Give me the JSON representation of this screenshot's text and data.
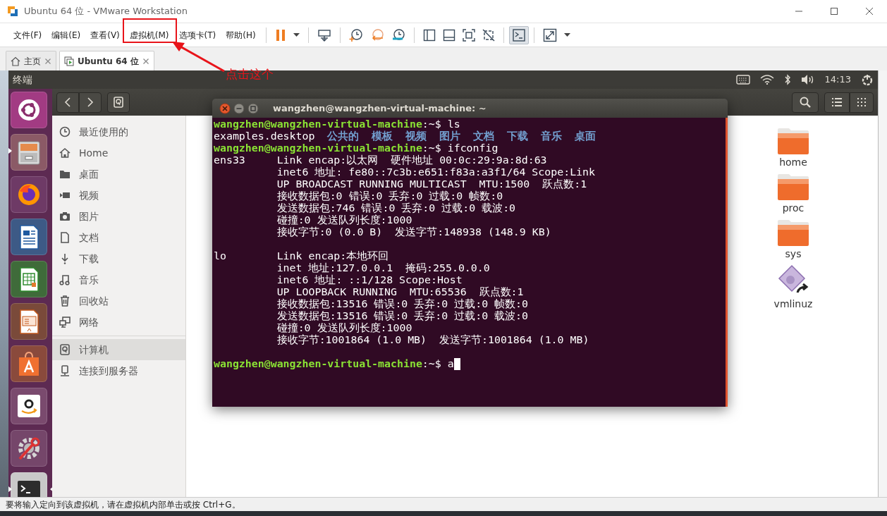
{
  "window": {
    "title": "Ubuntu 64 位 - VMware Workstation"
  },
  "menu": [
    "文件(F)",
    "编辑(E)",
    "查看(V)",
    "虚拟机(M)",
    "选项卡(T)",
    "帮助(H)"
  ],
  "toolbar": [
    {
      "buttons": [
        {
          "kind": "pause",
          "pressed": false
        },
        {
          "kind": "caret",
          "pressed": false
        }
      ]
    },
    {
      "buttons": [
        {
          "kind": "send_keys",
          "pressed": false
        }
      ]
    },
    {
      "buttons": [
        {
          "kind": "snapshot_take",
          "pressed": false
        },
        {
          "kind": "snapshot_revert",
          "pressed": false
        },
        {
          "kind": "snapshot_manager",
          "pressed": false
        }
      ]
    },
    {
      "buttons": [
        {
          "kind": "library",
          "pressed": false
        },
        {
          "kind": "thumbnail",
          "pressed": false
        },
        {
          "kind": "fullscreen",
          "pressed": false
        },
        {
          "kind": "unity",
          "pressed": false
        }
      ]
    },
    {
      "buttons": [
        {
          "kind": "console",
          "pressed": true
        }
      ]
    },
    {
      "buttons": [
        {
          "kind": "stretch",
          "pressed": false
        },
        {
          "kind": "caret",
          "pressed": false
        }
      ]
    }
  ],
  "tabs": [
    {
      "label": "主页",
      "kind": "home",
      "selected": false
    },
    {
      "label": "Ubuntu 64 位",
      "kind": "vm",
      "selected": true
    }
  ],
  "annotation": {
    "text": "点击这个"
  },
  "guest": {
    "panel_title": "终端",
    "clock": "14:13",
    "launcher": [
      {
        "kind": "ubuntu",
        "running": false,
        "focused": false
      },
      {
        "kind": "files",
        "running": true,
        "focused": false
      },
      {
        "kind": "firefox",
        "running": false,
        "focused": false
      },
      {
        "kind": "writer",
        "running": false,
        "focused": false
      },
      {
        "kind": "calc",
        "running": false,
        "focused": false
      },
      {
        "kind": "impress",
        "running": false,
        "focused": false
      },
      {
        "kind": "software",
        "running": false,
        "focused": false
      },
      {
        "kind": "amazon",
        "running": false,
        "focused": false
      },
      {
        "kind": "settings",
        "running": false,
        "focused": false
      },
      {
        "kind": "terminal",
        "running": true,
        "focused": true
      }
    ],
    "files": {
      "sections": [
        {
          "items": [
            {
              "label": "最近使用的",
              "selected": false
            },
            {
              "label": "Home",
              "selected": false
            },
            {
              "label": "桌面",
              "selected": false
            },
            {
              "label": "视频",
              "selected": false
            },
            {
              "label": "图片",
              "selected": false
            },
            {
              "label": "文档",
              "selected": false
            },
            {
              "label": "下载",
              "selected": false
            },
            {
              "label": "音乐",
              "selected": false
            },
            {
              "label": "回收站",
              "selected": false
            },
            {
              "label": "网络",
              "selected": false
            }
          ]
        },
        {
          "items": [
            {
              "label": "计算机",
              "selected": true
            },
            {
              "label": "连接到服务器",
              "selected": false
            }
          ]
        }
      ],
      "items": [
        {
          "name": "home",
          "kind": "folder"
        },
        {
          "name": "proc",
          "kind": "folder"
        },
        {
          "name": "sys",
          "kind": "folder"
        },
        {
          "name": "vmlinuz",
          "kind": "link"
        }
      ]
    },
    "terminal": {
      "title": "wangzhen@wangzhen-virtual-machine: ~",
      "cursor": true,
      "blocks": [
        {
          "lines": [
            [
              {
                "text": "wangzhen@wangzhen-virtual-machine",
                "kind": "prompt"
              },
              {
                "text": ":~$ ls",
                "kind": "plain"
              }
            ],
            [
              {
                "text": "examples.desktop",
                "kind": "plain"
              },
              {
                "text": "公共的",
                "kind": "dir"
              },
              {
                "text": "模板",
                "kind": "dir"
              },
              {
                "text": "视频",
                "kind": "dir"
              },
              {
                "text": "图片",
                "kind": "dir"
              },
              {
                "text": "文档",
                "kind": "dir"
              },
              {
                "text": "下载",
                "kind": "dir"
              },
              {
                "text": "音乐",
                "kind": "dir"
              },
              {
                "text": "桌面",
                "kind": "dir"
              }
            ],
            [
              {
                "text": "wangzhen@wangzhen-virtual-machine",
                "kind": "prompt"
              },
              {
                "text": ":~$ ifconfig",
                "kind": "plain"
              }
            ],
            [
              {
                "text": "ens33     Link encap:以太网  硬件地址 00:0c:29:9a:8d:63",
                "kind": "plain"
              }
            ],
            [
              {
                "text": "          inet6 地址: fe80::7c3b:e651:f83a:a3f1/64 Scope:Link",
                "kind": "plain"
              }
            ],
            [
              {
                "text": "          UP BROADCAST RUNNING MULTICAST  MTU:1500  跃点数:1",
                "kind": "plain"
              }
            ],
            [
              {
                "text": "          接收数据包:0 错误:0 丢弃:0 过载:0 帧数:0",
                "kind": "plain"
              }
            ],
            [
              {
                "text": "          发送数据包:746 错误:0 丢弃:0 过载:0 载波:0",
                "kind": "plain"
              }
            ],
            [
              {
                "text": "          碰撞:0 发送队列长度:1000",
                "kind": "plain"
              }
            ],
            [
              {
                "text": "          接收字节:0 (0.0 B)  发送字节:148938 (148.9 KB)",
                "kind": "plain"
              }
            ]
          ]
        },
        {
          "lines": [
            [
              {
                "text": "lo        Link encap:本地环回",
                "kind": "plain"
              }
            ],
            [
              {
                "text": "          inet 地址:127.0.0.1  掩码:255.0.0.0",
                "kind": "plain"
              }
            ],
            [
              {
                "text": "          inet6 地址: ::1/128 Scope:Host",
                "kind": "plain"
              }
            ],
            [
              {
                "text": "          UP LOOPBACK RUNNING  MTU:65536  跃点数:1",
                "kind": "plain"
              }
            ],
            [
              {
                "text": "          接收数据包:13516 错误:0 丢弃:0 过载:0 帧数:0",
                "kind": "plain"
              }
            ],
            [
              {
                "text": "          发送数据包:13516 错误:0 丢弃:0 过载:0 载波:0",
                "kind": "plain"
              }
            ],
            [
              {
                "text": "          碰撞:0 发送队列长度:1000",
                "kind": "plain"
              }
            ],
            [
              {
                "text": "          接收字节:1001864 (1.0 MB)  发送字节:1001864 (1.0 MB)",
                "kind": "plain"
              }
            ]
          ]
        },
        {
          "lines": [
            [
              {
                "text": "wangzhen@wangzhen-virtual-machine",
                "kind": "prompt"
              },
              {
                "text": ":~$ a",
                "kind": "plain"
              }
            ]
          ]
        }
      ]
    }
  },
  "status_bar": "要将输入定向到该虚拟机，请在虚拟机内部单击或按 Ctrl+G。"
}
